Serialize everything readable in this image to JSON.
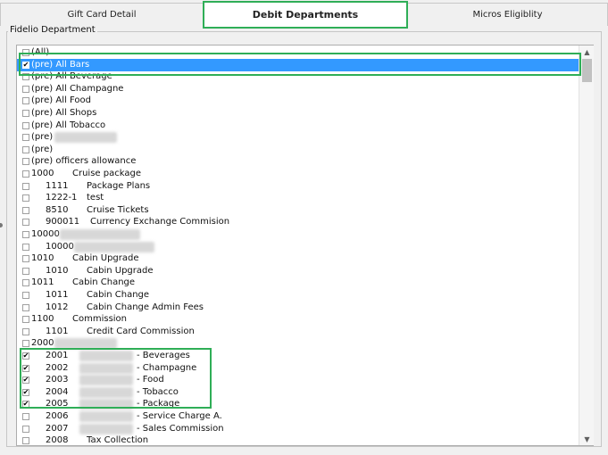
{
  "tabs": [
    {
      "label": "Gift Card Detail",
      "active": false
    },
    {
      "label": "Debit Departments",
      "active": true
    },
    {
      "label": "Micros Eligiblity",
      "active": false
    }
  ],
  "group": {
    "label": "Fidelio Department"
  },
  "colors": {
    "selection": "#3399ff",
    "highlight": "#2fae57"
  },
  "list": {
    "rows": [
      {
        "code": "(All)",
        "desc": "",
        "checked": false
      },
      {
        "code": "(pre) All Bars",
        "desc": "",
        "checked": true,
        "selected": true
      },
      {
        "code": "(pre) All Beverage",
        "desc": "",
        "checked": false
      },
      {
        "code": "(pre) All Champagne",
        "desc": "",
        "checked": false
      },
      {
        "code": "(pre) All Food",
        "desc": "",
        "checked": false
      },
      {
        "code": "(pre) All Shops",
        "desc": "",
        "checked": false
      },
      {
        "code": "(pre) All Tobacco",
        "desc": "",
        "checked": false
      },
      {
        "code": "(pre)",
        "desc": "",
        "checked": false,
        "redacted": true
      },
      {
        "code": "(pre)",
        "desc": "",
        "checked": false
      },
      {
        "code": "(pre) officers allowance",
        "desc": "",
        "checked": false
      },
      {
        "code": "1000",
        "desc": "Cruise package",
        "checked": false
      },
      {
        "code": "1111",
        "desc": "Package Plans",
        "checked": false,
        "indent": true
      },
      {
        "code": "1222-1",
        "desc": "test",
        "checked": false,
        "indent": true
      },
      {
        "code": "8510",
        "desc": "Cruise Tickets",
        "checked": false,
        "indent": true
      },
      {
        "code": "900011",
        "desc": "Currency Exchange Commision",
        "checked": false,
        "indent": true
      },
      {
        "code": "10000",
        "desc": "",
        "checked": false,
        "redacted": true
      },
      {
        "code": "10000",
        "desc": "",
        "checked": false,
        "indent": true,
        "redacted": true
      },
      {
        "code": "1010",
        "desc": "Cabin Upgrade",
        "checked": false
      },
      {
        "code": "1010",
        "desc": "Cabin Upgrade",
        "checked": false,
        "indent": true
      },
      {
        "code": "1011",
        "desc": "Cabin Change",
        "checked": false
      },
      {
        "code": "1011",
        "desc": "Cabin Change",
        "checked": false,
        "indent": true
      },
      {
        "code": "1012",
        "desc": "Cabin Change Admin Fees",
        "checked": false,
        "indent": true
      },
      {
        "code": "1100",
        "desc": "Commission",
        "checked": false
      },
      {
        "code": "1101",
        "desc": "Credit Card Commission",
        "checked": false,
        "indent": true
      },
      {
        "code": "2000",
        "desc": "",
        "checked": false,
        "redacted": true
      },
      {
        "code": "2001",
        "desc": "- Beverages",
        "checked": true,
        "indent": true,
        "redacted": true
      },
      {
        "code": "2002",
        "desc": "- Champagne",
        "checked": true,
        "indent": true,
        "redacted": true
      },
      {
        "code": "2003",
        "desc": "- Food",
        "checked": true,
        "indent": true,
        "redacted": true
      },
      {
        "code": "2004",
        "desc": "- Tobacco",
        "checked": true,
        "indent": true,
        "redacted": true
      },
      {
        "code": "2005",
        "desc": "- Package",
        "checked": true,
        "indent": true,
        "redacted": true
      },
      {
        "code": "2006",
        "desc": "- Service Charge A.",
        "checked": false,
        "indent": true,
        "redacted": true
      },
      {
        "code": "2007",
        "desc": "- Sales Commission",
        "checked": false,
        "indent": true,
        "redacted": true
      },
      {
        "code": "2008",
        "desc": "Tax Collection",
        "checked": false,
        "indent": true
      }
    ]
  },
  "scrollbar": {
    "up_icon": "chevron-up-icon",
    "down_icon": "chevron-down-icon"
  }
}
